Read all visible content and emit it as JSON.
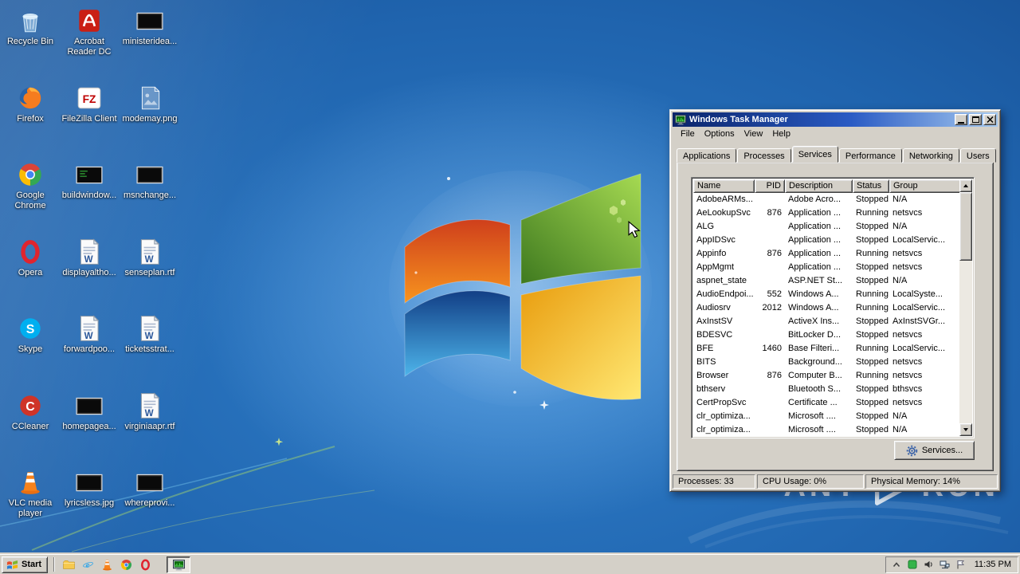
{
  "desktop": {
    "icons": [
      {
        "label": "Recycle Bin",
        "icon": "recycle-bin",
        "col": 0,
        "row": 0
      },
      {
        "label": "Acrobat Reader DC",
        "icon": "acrobat",
        "col": 1,
        "row": 0
      },
      {
        "label": "ministeridea...",
        "icon": "image-black",
        "col": 2,
        "row": 0
      },
      {
        "label": "Firefox",
        "icon": "firefox",
        "col": 0,
        "row": 1
      },
      {
        "label": "FileZilla Client",
        "icon": "filezilla",
        "col": 1,
        "row": 1
      },
      {
        "label": "modemay.png",
        "icon": "image-faint",
        "col": 2,
        "row": 1
      },
      {
        "label": "Google Chrome",
        "icon": "chrome",
        "col": 0,
        "row": 2
      },
      {
        "label": "buildwindow...",
        "icon": "console-thumb",
        "col": 1,
        "row": 2
      },
      {
        "label": "msnchange...",
        "icon": "image-black",
        "col": 2,
        "row": 2
      },
      {
        "label": "Opera",
        "icon": "opera",
        "col": 0,
        "row": 3
      },
      {
        "label": "displayaltho...",
        "icon": "word-doc",
        "col": 1,
        "row": 3
      },
      {
        "label": "senseplan.rtf",
        "icon": "word-doc",
        "col": 2,
        "row": 3
      },
      {
        "label": "Skype",
        "icon": "skype",
        "col": 0,
        "row": 4
      },
      {
        "label": "forwardpoo...",
        "icon": "word-doc",
        "col": 1,
        "row": 4
      },
      {
        "label": "ticketsstrat...",
        "icon": "word-doc",
        "col": 2,
        "row": 4
      },
      {
        "label": "CCleaner",
        "icon": "ccleaner",
        "col": 0,
        "row": 5
      },
      {
        "label": "homepagea...",
        "icon": "image-black",
        "col": 1,
        "row": 5
      },
      {
        "label": "virginiaapr.rtf",
        "icon": "word-doc",
        "col": 2,
        "row": 5
      },
      {
        "label": "VLC media player",
        "icon": "vlc",
        "col": 0,
        "row": 6
      },
      {
        "label": "lyricsless.jpg",
        "icon": "image-black",
        "col": 1,
        "row": 6
      },
      {
        "label": "whereprovi...",
        "icon": "image-black",
        "col": 2,
        "row": 6
      }
    ]
  },
  "watermark": {
    "left": "ANY",
    "right": "RUN"
  },
  "task_manager": {
    "title": "Windows Task Manager",
    "menus": [
      "File",
      "Options",
      "View",
      "Help"
    ],
    "tabs": [
      "Applications",
      "Processes",
      "Services",
      "Performance",
      "Networking",
      "Users"
    ],
    "active_tab": "Services",
    "columns": [
      "Name",
      "PID",
      "Description",
      "Status",
      "Group"
    ],
    "services": [
      {
        "name": "AdobeARMs...",
        "pid": "",
        "description": "Adobe Acro...",
        "status": "Stopped",
        "group": "N/A"
      },
      {
        "name": "AeLookupSvc",
        "pid": "876",
        "description": "Application ...",
        "status": "Running",
        "group": "netsvcs"
      },
      {
        "name": "ALG",
        "pid": "",
        "description": "Application ...",
        "status": "Stopped",
        "group": "N/A"
      },
      {
        "name": "AppIDSvc",
        "pid": "",
        "description": "Application ...",
        "status": "Stopped",
        "group": "LocalServic..."
      },
      {
        "name": "Appinfo",
        "pid": "876",
        "description": "Application ...",
        "status": "Running",
        "group": "netsvcs"
      },
      {
        "name": "AppMgmt",
        "pid": "",
        "description": "Application ...",
        "status": "Stopped",
        "group": "netsvcs"
      },
      {
        "name": "aspnet_state",
        "pid": "",
        "description": "ASP.NET St...",
        "status": "Stopped",
        "group": "N/A"
      },
      {
        "name": "AudioEndpoi...",
        "pid": "552",
        "description": "Windows A...",
        "status": "Running",
        "group": "LocalSyste..."
      },
      {
        "name": "Audiosrv",
        "pid": "2012",
        "description": "Windows A...",
        "status": "Running",
        "group": "LocalServic..."
      },
      {
        "name": "AxInstSV",
        "pid": "",
        "description": "ActiveX Ins...",
        "status": "Stopped",
        "group": "AxInstSVGr..."
      },
      {
        "name": "BDESVC",
        "pid": "",
        "description": "BitLocker D...",
        "status": "Stopped",
        "group": "netsvcs"
      },
      {
        "name": "BFE",
        "pid": "1460",
        "description": "Base Filteri...",
        "status": "Running",
        "group": "LocalServic..."
      },
      {
        "name": "BITS",
        "pid": "",
        "description": "Background...",
        "status": "Stopped",
        "group": "netsvcs"
      },
      {
        "name": "Browser",
        "pid": "876",
        "description": "Computer B...",
        "status": "Running",
        "group": "netsvcs"
      },
      {
        "name": "bthserv",
        "pid": "",
        "description": "Bluetooth S...",
        "status": "Stopped",
        "group": "bthsvcs"
      },
      {
        "name": "CertPropSvc",
        "pid": "",
        "description": "Certificate ...",
        "status": "Stopped",
        "group": "netsvcs"
      },
      {
        "name": "clr_optimiza...",
        "pid": "",
        "description": "Microsoft ....",
        "status": "Stopped",
        "group": "N/A"
      },
      {
        "name": "clr_optimiza...",
        "pid": "",
        "description": "Microsoft ....",
        "status": "Stopped",
        "group": "N/A"
      }
    ],
    "services_button": "Services...",
    "status_bar": {
      "processes": "Processes: 33",
      "cpu": "CPU Usage: 0%",
      "memory": "Physical Memory: 14%"
    }
  },
  "taskbar": {
    "start_label": "Start",
    "quick_launch": [
      "windows-explorer",
      "internet-explorer",
      "vlc",
      "google-chrome",
      "opera"
    ],
    "running": [
      "task-manager"
    ],
    "tray_icons": [
      "hidden-icons",
      "agent",
      "volume",
      "network",
      "action-center"
    ],
    "clock": "11:35 PM"
  },
  "colors": {
    "titlebar_start": "#0a246a",
    "titlebar_end": "#a6caf0",
    "chrome_gray": "#d4d0c8",
    "desktop_blue": "#1f63ad"
  }
}
